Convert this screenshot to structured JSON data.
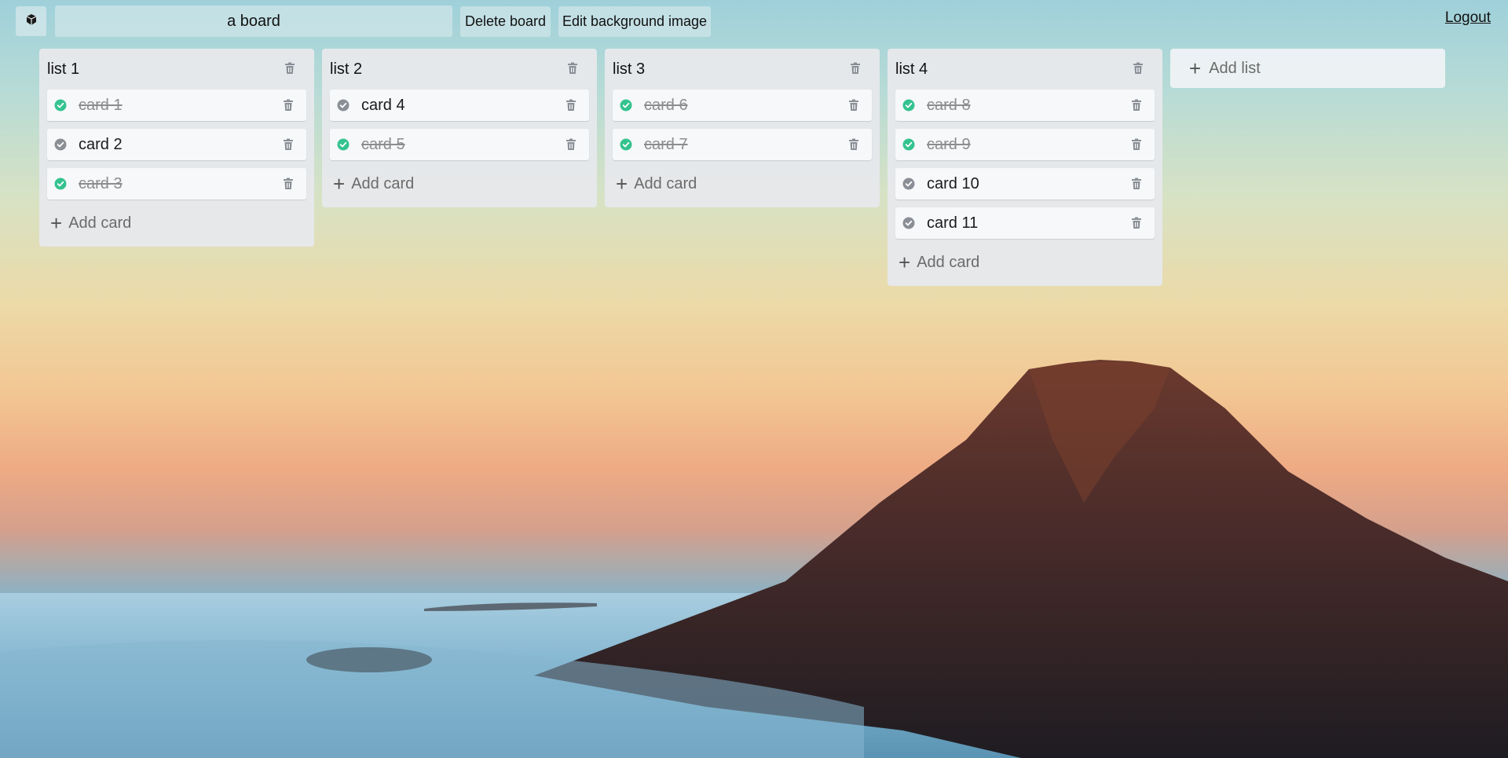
{
  "header": {
    "board_title": "a board",
    "delete_board_label": "Delete board",
    "edit_background_label": "Edit background image",
    "logout_label": "Logout",
    "home_icon": "cube-icon"
  },
  "lists": [
    {
      "title": "list 1",
      "cards": [
        {
          "text": "card 1",
          "done": true
        },
        {
          "text": "card 2",
          "done": false
        },
        {
          "text": "card 3",
          "done": true
        }
      ],
      "add_card_label": "Add card"
    },
    {
      "title": "list 2",
      "cards": [
        {
          "text": "card 4",
          "done": false
        },
        {
          "text": "card 5",
          "done": true
        }
      ],
      "add_card_label": "Add card"
    },
    {
      "title": "list 3",
      "cards": [
        {
          "text": "card 6",
          "done": true
        },
        {
          "text": "card 7",
          "done": true
        }
      ],
      "add_card_label": "Add card"
    },
    {
      "title": "list 4",
      "cards": [
        {
          "text": "card 8",
          "done": true
        },
        {
          "text": "card 9",
          "done": true
        },
        {
          "text": "card 10",
          "done": false
        },
        {
          "text": "card 11",
          "done": false
        }
      ],
      "add_card_label": "Add card"
    }
  ],
  "add_list_label": "Add list",
  "colors": {
    "done_check": "#34c38f",
    "undone_check": "#8a8f96",
    "trash_icon": "#8a8f96"
  }
}
